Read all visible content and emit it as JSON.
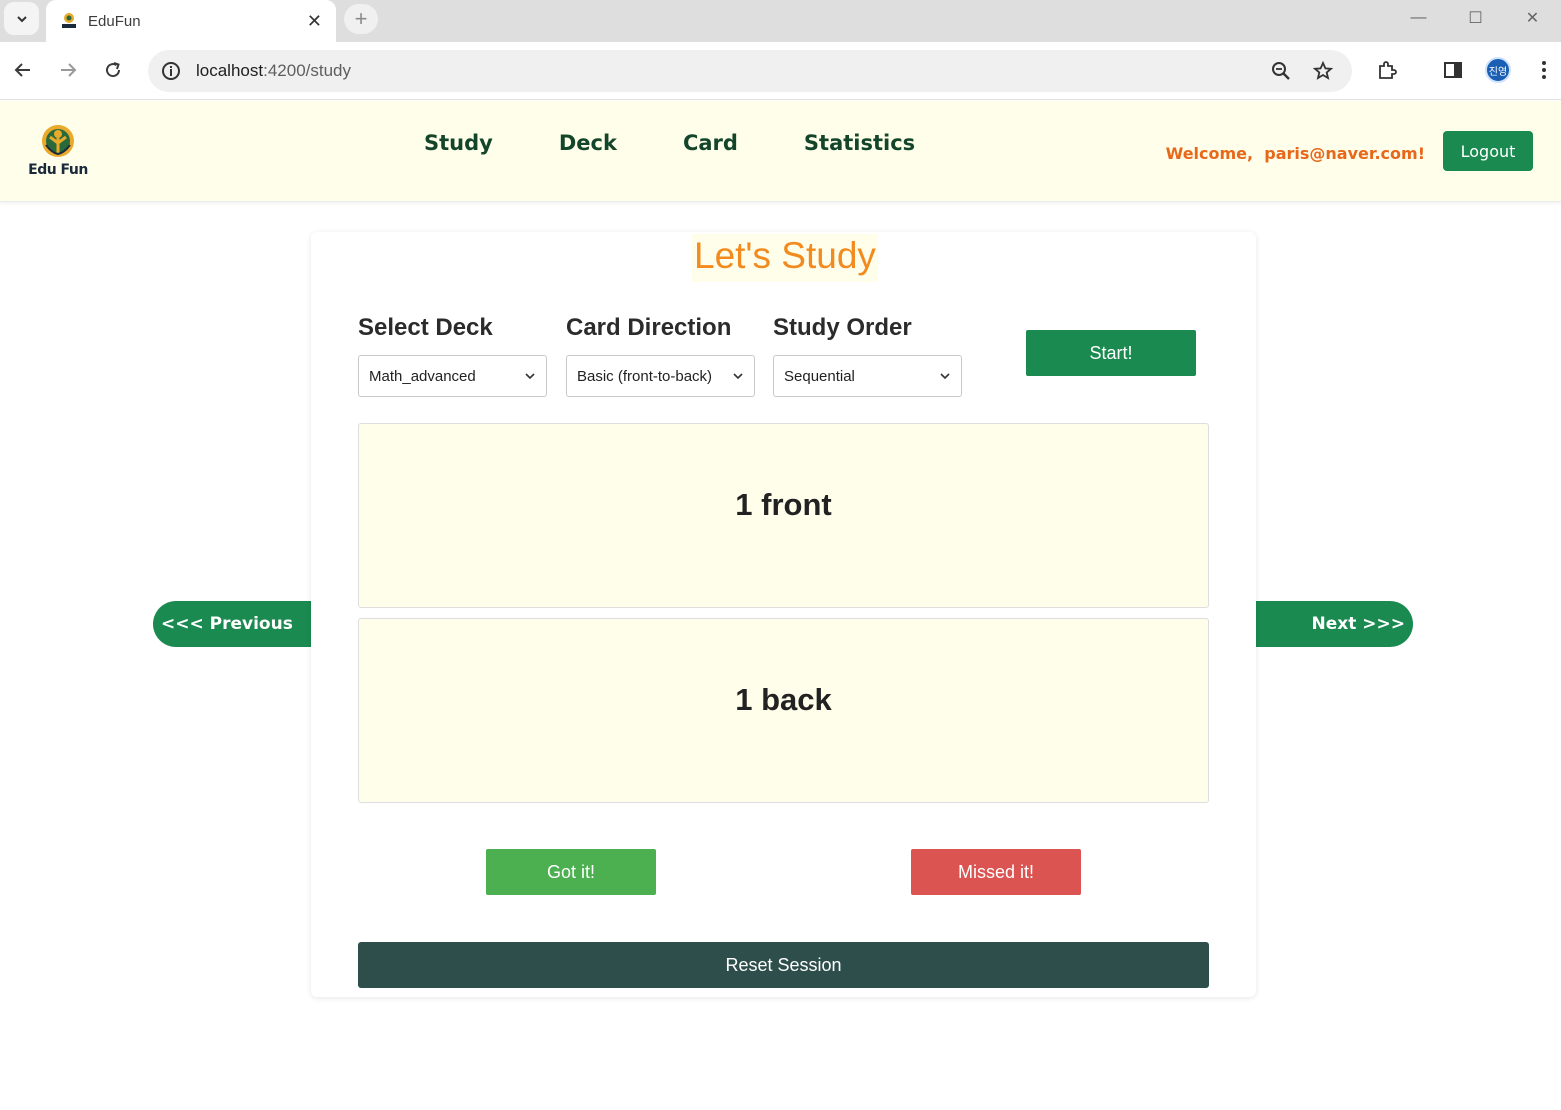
{
  "browser": {
    "tab_title": "EduFun",
    "url_host": "localhost",
    "url_path": ":4200/study",
    "profile_initials": "진영"
  },
  "header": {
    "logo_text": "Edu Fun",
    "nav": [
      "Study",
      "Deck",
      "Card",
      "Statistics"
    ],
    "welcome": "Welcome,  paris@naver.com!",
    "logout_label": "Logout"
  },
  "study": {
    "title": "Let's Study",
    "deck_label": "Select Deck",
    "deck_value": "Math_advanced",
    "direction_label": "Card Direction",
    "direction_value": "Basic (front-to-back)",
    "order_label": "Study Order",
    "order_value": "Sequential",
    "start_label": "Start!",
    "card_front": "1 front",
    "card_back": "1 back",
    "got_label": "Got it!",
    "missed_label": "Missed it!",
    "reset_label": "Reset Session",
    "prev_label": "<<< Previous",
    "next_label": "Next >>>"
  },
  "colors": {
    "brand_green": "#1a8a50",
    "accent_orange": "#f28a1e",
    "got_green": "#4caf50",
    "missed_red": "#dc5451",
    "reset_dark": "#2e4e4c",
    "header_bg": "#fffeea"
  }
}
